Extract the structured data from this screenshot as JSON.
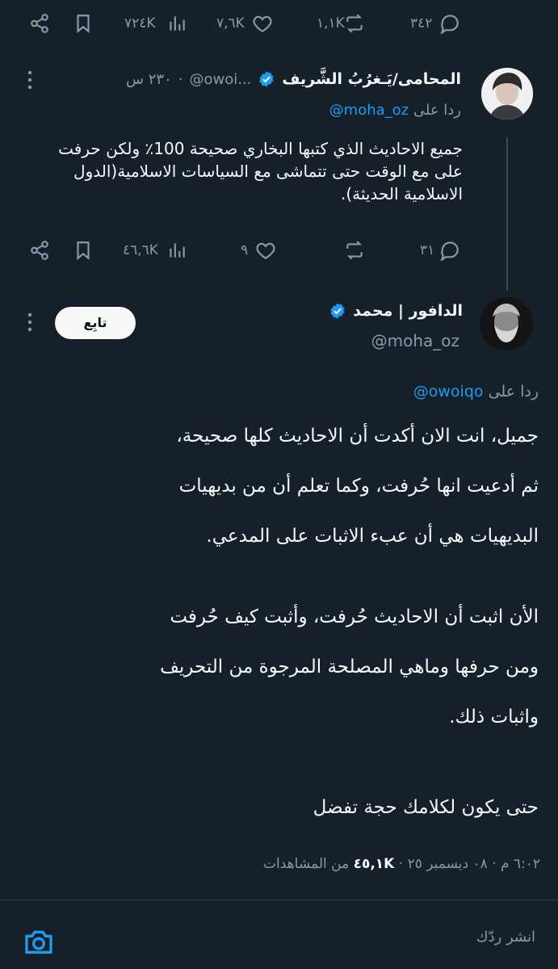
{
  "top_actions": {
    "replies": "٣٤٢",
    "reposts": "١,١K",
    "likes": "٧,٦K",
    "views": "٧٢٤K"
  },
  "tweet1": {
    "name": "المحامى/يَـغرُبُ الشَّريف",
    "handle": "@owoi...",
    "time": "٢٣٠ س",
    "reply_prefix": "ردا على",
    "reply_handle": "@moha_oz",
    "text": "جميع الاحاديث الذي كتبها البخاري صحيحة 100٪ ولكن حرفت على مع الوقت حتى تتماشى مع السياسات الاسلامية(الدول الاسلامية الحديثة).",
    "replies": "٣١",
    "likes": "٩",
    "views": "٤٦,٦K",
    "verified_color": "#1d9bf0"
  },
  "tweet2": {
    "name": "الدافور | محمد",
    "handle": "@moha_oz",
    "follow_label": "تابِع",
    "reply_prefix": "ردا على",
    "reply_handle": "@owoiqo",
    "lines": [
      "جميل، انت الان أكدت أن الاحاديث كلها صحيحة،",
      "ثم أدعيت انها حُرفت، وكما تعلم أن من بديهيات",
      "البديهيات هي أن عبء الاثبات على المدعي.",
      "الأن اثبت أن الاحاديث حُرفت، وأثبت كيف حُرفت",
      "ومن حرفها وماهي المصلحة المرجوة من التحريف",
      "واثبات ذلك.",
      "حتى يكون لكلامك حجة تفضل"
    ],
    "timestamp": "٦:٠٢ م · ٠٨ ديسمبر ٢٥ ·",
    "views_count": "٤٥,١K",
    "views_label": "من المشاهدات"
  },
  "compose": {
    "placeholder": "انشر ردّك"
  },
  "colors": {
    "background": "#15202b",
    "accent": "#1d9bf0",
    "muted": "#8b98a5"
  }
}
